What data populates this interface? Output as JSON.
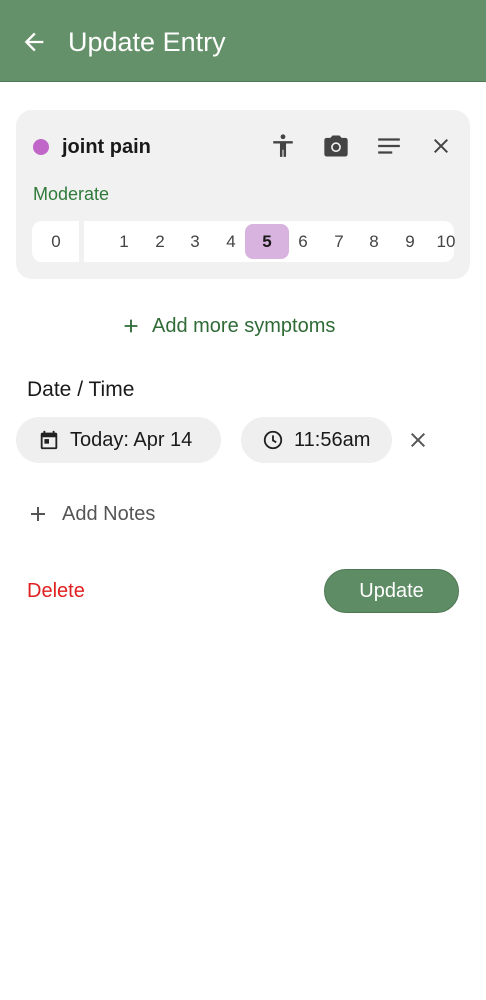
{
  "header": {
    "title": "Update Entry",
    "background": "#65916a"
  },
  "symptom": {
    "name": "joint pain",
    "dot_color": "#c066c8",
    "severity_label": "Moderate",
    "scale": [
      "0",
      "1",
      "2",
      "3",
      "4",
      "5",
      "6",
      "7",
      "8",
      "9",
      "10"
    ],
    "selected": "5",
    "icons": [
      "body-icon",
      "camera-icon",
      "notes-icon",
      "close-icon"
    ]
  },
  "actions": {
    "add_more_label": "Add more symptoms",
    "add_notes_label": "Add Notes",
    "delete_label": "Delete",
    "update_label": "Update"
  },
  "datetime": {
    "section_title": "Date / Time",
    "date_label": "Today: Apr 14",
    "time_label": "11:56am"
  },
  "colors": {
    "accent": "#5e8c64",
    "delete": "#e02020",
    "selected_severity": "#d9b3df"
  }
}
